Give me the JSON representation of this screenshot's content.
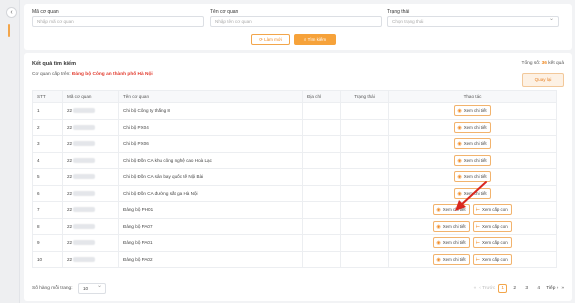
{
  "filters": {
    "code_label": "Mã cơ quan",
    "code_placeholder": "Nhập mã cơ quan",
    "name_label": "Tên cơ quan",
    "name_placeholder": "Nhập tên cơ quan",
    "status_label": "Trạng thái",
    "status_placeholder": "Chọn trạng thái",
    "reset_label": "Làm mới",
    "search_label": "Tìm kiếm"
  },
  "results": {
    "title": "Kết quả tìm kiếm",
    "total_prefix": "Tổng số:",
    "total_count": "36",
    "total_suffix": "kết quả",
    "parent_prefix": "Cơ quan cấp trên:",
    "parent_org": "Đảng bộ Công an thành phố Hà Nội",
    "back_label": "Quay lại"
  },
  "table": {
    "headers": [
      "STT",
      "Mã cơ quan",
      "Tên cơ quan",
      "Địa chỉ",
      "Trạng thái",
      "Thao tác"
    ],
    "detail_label": "Xem chi tiết",
    "child_label": "Xem cấp con",
    "rows": [
      {
        "stt": "1",
        "code": "22",
        "name": "Chi bộ Công ty thắng 8",
        "has_child": false
      },
      {
        "stt": "2",
        "code": "22",
        "name": "Chi bộ PX04",
        "has_child": false
      },
      {
        "stt": "3",
        "code": "22",
        "name": "Chi bộ PX06",
        "has_child": false
      },
      {
        "stt": "4",
        "code": "22",
        "name": "Chi bộ Đồn CA khu công nghệ cao Hoà Lạc",
        "has_child": false
      },
      {
        "stt": "5",
        "code": "22",
        "name": "Chi bộ Đồn CA sân bay quốc tế Nội Bài",
        "has_child": false
      },
      {
        "stt": "6",
        "code": "22",
        "name": "Chi bộ Đồn CA đường sắt ga Hà Nội",
        "has_child": false
      },
      {
        "stt": "7",
        "code": "22",
        "name": "Đảng bộ PH01",
        "has_child": true
      },
      {
        "stt": "8",
        "code": "22",
        "name": "Đảng bộ PA07",
        "has_child": true
      },
      {
        "stt": "9",
        "code": "22",
        "name": "Đảng bộ PA01",
        "has_child": true
      },
      {
        "stt": "10",
        "code": "22",
        "name": "Đảng bộ PA02",
        "has_child": true
      }
    ]
  },
  "pagination": {
    "page_size_label": "Số hàng mỗi trang:",
    "page_size": "10",
    "prev_label": "Trước",
    "next_label": "Tiếp",
    "pages": [
      "1",
      "2",
      "3",
      "4"
    ],
    "current_page": "1"
  },
  "icons": {
    "eye": "eye-icon",
    "hierarchy": "hierarchy-icon",
    "refresh": "refresh-icon",
    "search": "search-icon"
  },
  "colors": {
    "accent": "#f6a23a",
    "accent_text": "#f08a24",
    "highlight_red": "#e23b2e",
    "annotation_arrow": "#d9281f"
  }
}
